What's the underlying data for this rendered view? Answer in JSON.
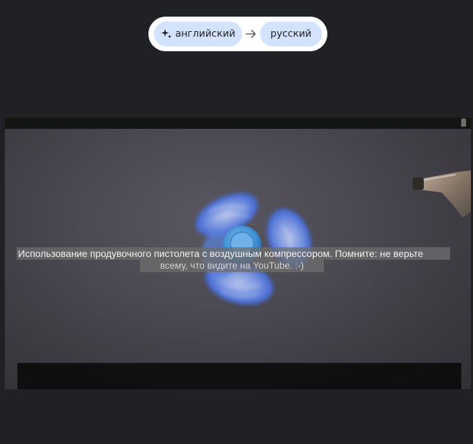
{
  "translation_bar": {
    "source_language": "английский",
    "target_language": "русский",
    "sparkle_icon": "sparkle-icon",
    "arrow_icon": "arrow-right-icon"
  },
  "video": {
    "menu_icon": "more-vertical-icon",
    "caption": {
      "line1": "Использование продувочного пистолета с воздушным компрессором. Помните: не верьте",
      "line2": "всему, что видите на YouTube. :-)"
    }
  },
  "colors": {
    "page_background": "#202124",
    "pill_background": "#ffffff",
    "chip_background": "#d3e3fd",
    "spinner_blue": "#4b78e6"
  }
}
